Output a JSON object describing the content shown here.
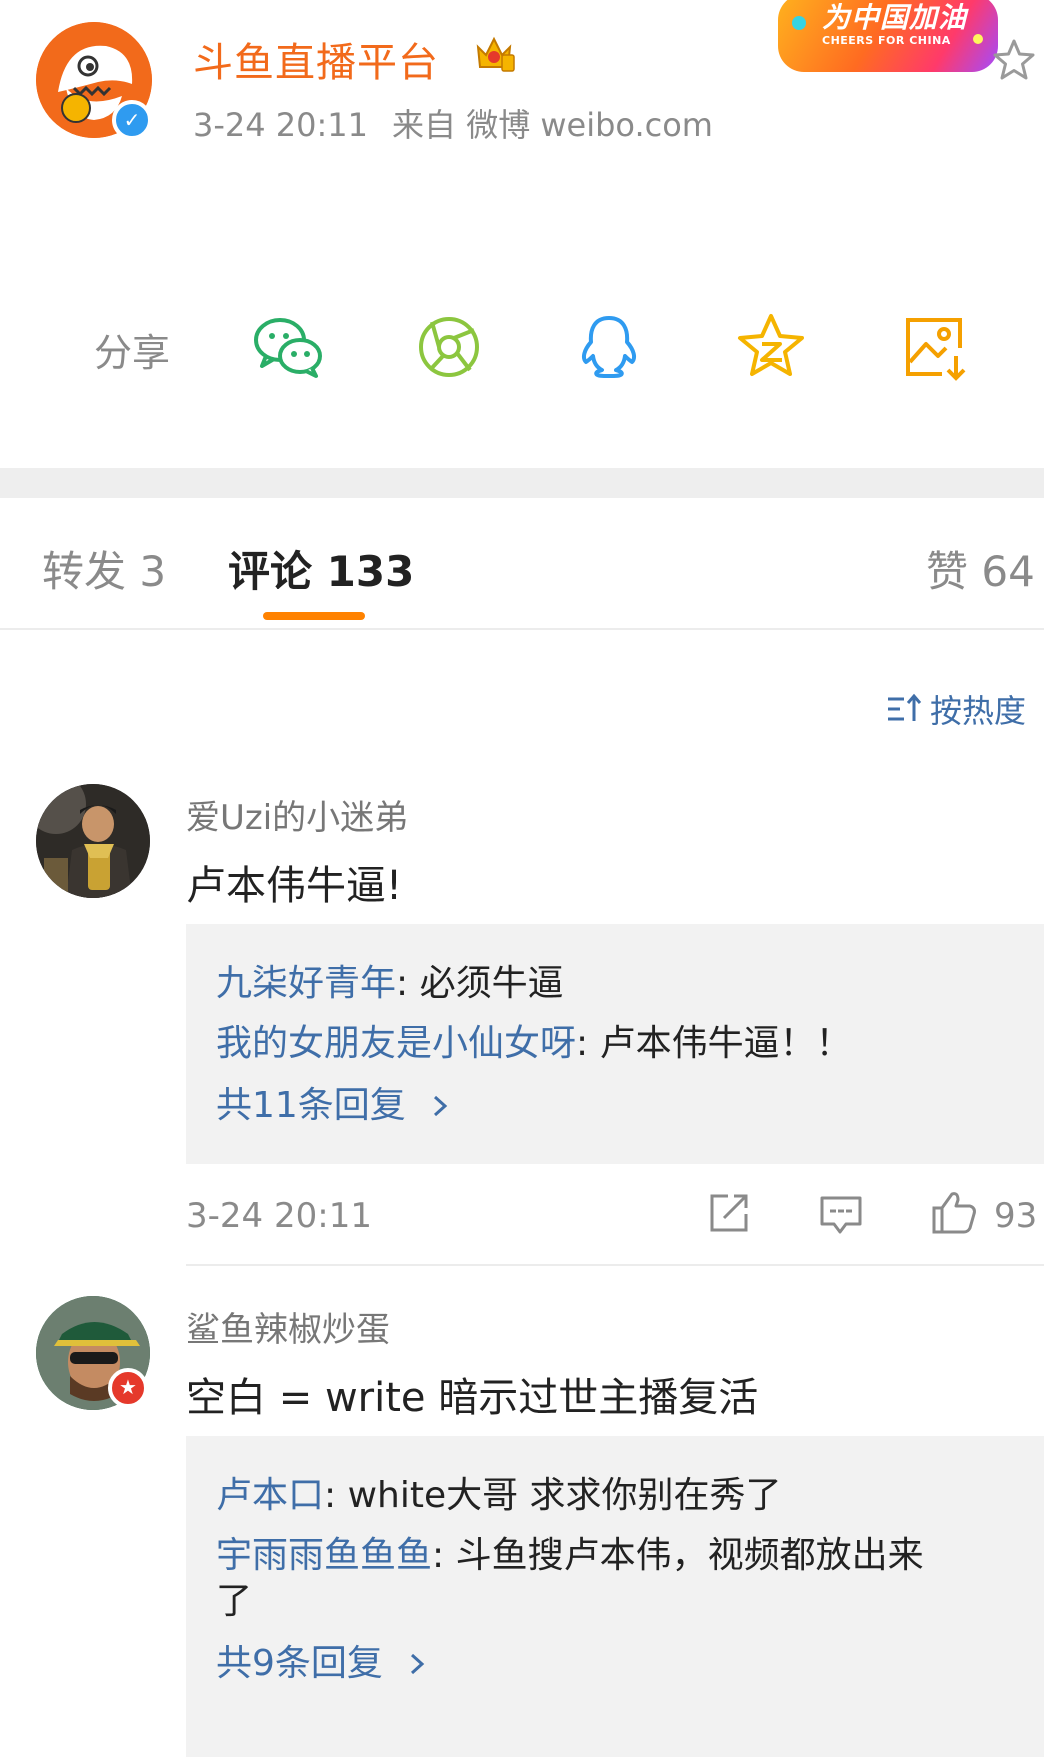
{
  "post": {
    "author": "斗鱼直播平台",
    "date": "3-24 20:11",
    "source_label": "来自 微博 weibo.com"
  },
  "banner": {
    "title": "为中国加油",
    "subtitle": "CHEERS FOR CHINA"
  },
  "share": {
    "label": "分享",
    "icons": [
      "wechat-icon",
      "moments-icon",
      "qq-icon",
      "qzone-icon",
      "save-image-icon"
    ]
  },
  "tabs": {
    "reposts": "转发 3",
    "comments": "评论 133",
    "likes": "赞 64"
  },
  "sort_label": "按热度",
  "colors": {
    "brand_orange": "#ff8200",
    "link_blue": "#3f6ea8",
    "wechat_green": "#2aae67",
    "moments_green": "#8cc63f",
    "qq_blue": "#2f9bf0",
    "qzone_yellow": "#f5b400",
    "save_orange": "#f5a000"
  },
  "comments": [
    {
      "user": "爱Uzi的小迷弟",
      "text": "卢本伟牛逼!",
      "replies": [
        {
          "user": "九柒好青年",
          "text": ": 必须牛逼"
        },
        {
          "user": "我的女朋友是小仙女呀",
          "text": ": 卢本伟牛逼！！"
        }
      ],
      "more_replies": "共11条回复",
      "time": "3-24 20:11",
      "likes": "93"
    },
    {
      "user": "鲨鱼辣椒炒蛋",
      "text": "空白 = write 暗示过世主播复活",
      "replies": [
        {
          "user": "卢本口",
          "text": ": white大哥 求求你别在秀了"
        },
        {
          "user": "宇雨雨鱼鱼鱼",
          "text": ": 斗鱼搜卢本伟，视频都放出来"
        },
        {
          "user": "",
          "text": "了"
        }
      ],
      "more_replies": "共9条回复"
    }
  ]
}
